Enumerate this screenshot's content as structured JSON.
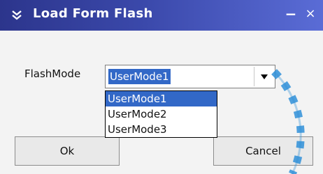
{
  "window": {
    "title": "Load Form Flash",
    "icon": "collapse-arrows-icon",
    "minimize_glyph": "−",
    "close_glyph": "×"
  },
  "form": {
    "flash_mode_label": "FlashMode",
    "flash_mode_value": "UserMode1",
    "options": [
      "UserMode1",
      "UserMode2",
      "UserMode3"
    ],
    "selected_index": 0
  },
  "buttons": {
    "ok_label": "Ok",
    "cancel_label": "Cancel"
  },
  "colors": {
    "titlebar_start": "#2c358c",
    "titlebar_end": "#5a6cd6",
    "selection": "#3268c7",
    "watermark": "#2f8fd8"
  }
}
